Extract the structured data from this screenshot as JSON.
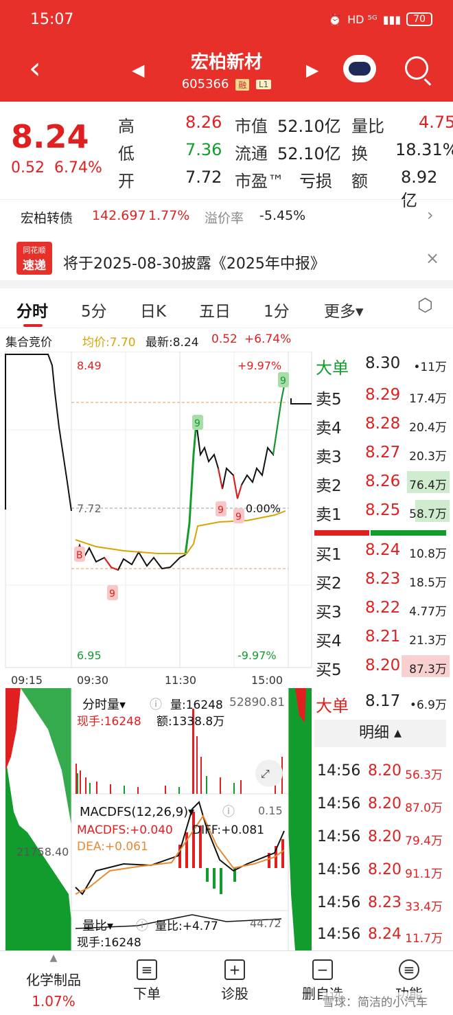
{
  "status_bar": {
    "time": "15:07",
    "network": "HD ⁵ᴳ",
    "battery": "70"
  },
  "header": {
    "stock_name": "宏柏新材",
    "stock_code": "605366",
    "tag_margin": "融",
    "tag_level": "L1"
  },
  "quote": {
    "price": "8.24",
    "change": "0.52",
    "change_pct": "6.74%",
    "high_label": "高",
    "high": "8.26",
    "low_label": "低",
    "low": "7.36",
    "open_label": "开",
    "open": "7.72",
    "mcap_label": "市值",
    "mcap": "52.10亿",
    "float_label": "流通",
    "float": "52.10亿",
    "pe_label": "市盈™",
    "pe": "亏损",
    "vol_ratio_label": "量比",
    "vol_ratio": "4.75",
    "turnover_label": "换",
    "turnover": "18.31%",
    "amount_label": "额",
    "amount": "8.92亿"
  },
  "bond": {
    "name": "宏柏转债",
    "price": "142.697",
    "pct": "1.77%",
    "premium_label": "溢价率",
    "premium": "-5.45%"
  },
  "notice": {
    "logo_top": "同花顺",
    "logo_bottom": "速递",
    "text": "将于2025-08-30披露《2025年中报》"
  },
  "tabs": [
    "分时",
    "5分",
    "日K",
    "五日",
    "1分",
    "更多▾"
  ],
  "chart_info": {
    "auction": "集合竞价",
    "avg": "均价:7.70",
    "latest": "最新:8.24",
    "chg": "0.52",
    "pct": "+6.74%"
  },
  "chart_labels": {
    "y_top": "8.49",
    "y_mid": "7.72",
    "y_bottom": "6.95",
    "pct_top": "+9.97%",
    "pct_mid": "0.00%",
    "pct_bottom": "-9.97%",
    "t1": "09:15",
    "t2": "09:30",
    "t3": "11:30",
    "t4": "15:00",
    "marker_b": "B",
    "marker_9": "9"
  },
  "volume_panel": {
    "title": "分时量▾",
    "vol": "量:16248",
    "hand": "现手:16248",
    "amount": "额:1338.8万",
    "max": "52890.81",
    "left_val": "21758.40"
  },
  "macd_panel": {
    "title": "MACDFS(12,26,9)▾",
    "macdfs": "MACDFS:+0.040",
    "diff": "DIFF:+0.081",
    "dea": "DEA:+0.061",
    "max": "0.15"
  },
  "ratio_panel": {
    "title": "量比▾",
    "ratio": "量比:+4.77",
    "hand": "现手:16248",
    "max": "44.72"
  },
  "order_book": {
    "big_sell": {
      "label": "大单",
      "price": "8.30",
      "vol": "•11万"
    },
    "asks": [
      {
        "label": "卖5",
        "price": "8.29",
        "vol": "17.4万"
      },
      {
        "label": "卖4",
        "price": "8.28",
        "vol": "20.4万"
      },
      {
        "label": "卖3",
        "price": "8.27",
        "vol": "20.3万"
      },
      {
        "label": "卖2",
        "price": "8.26",
        "vol": "76.4万"
      },
      {
        "label": "卖1",
        "price": "8.25",
        "vol": "58.7万"
      }
    ],
    "bids": [
      {
        "label": "买1",
        "price": "8.24",
        "vol": "10.8万"
      },
      {
        "label": "买2",
        "price": "8.23",
        "vol": "18.5万"
      },
      {
        "label": "买3",
        "price": "8.22",
        "vol": "4.77万"
      },
      {
        "label": "买4",
        "price": "8.21",
        "vol": "21.3万"
      },
      {
        "label": "买5",
        "price": "8.20",
        "vol": "87.3万"
      }
    ],
    "big_buy": {
      "label": "大单",
      "price": "8.17",
      "vol": "•6.9万"
    },
    "detail_label": "明细 ▴"
  },
  "ticks": [
    {
      "time": "14:56",
      "price": "8.20",
      "vol": "56.3万"
    },
    {
      "time": "14:56",
      "price": "8.20",
      "vol": "87.0万"
    },
    {
      "time": "14:56",
      "price": "8.20",
      "vol": "79.4万"
    },
    {
      "time": "14:56",
      "price": "8.20",
      "vol": "91.1万"
    },
    {
      "time": "14:56",
      "price": "8.23",
      "vol": "33.4万"
    },
    {
      "time": "14:56",
      "price": "8.24",
      "vol": "11.7万"
    }
  ],
  "bottom_nav": {
    "sector_name": "化学制品",
    "sector_pct": "1.07%",
    "order": "下单",
    "diagnose": "诊股",
    "delete": "删自选",
    "function": "功能",
    "watermark": "雪球：简洁的小汽车"
  },
  "colors": {
    "up": "#e02020",
    "down": "#139c2e",
    "header": "#e8302a",
    "avg_line": "#d9a400"
  }
}
